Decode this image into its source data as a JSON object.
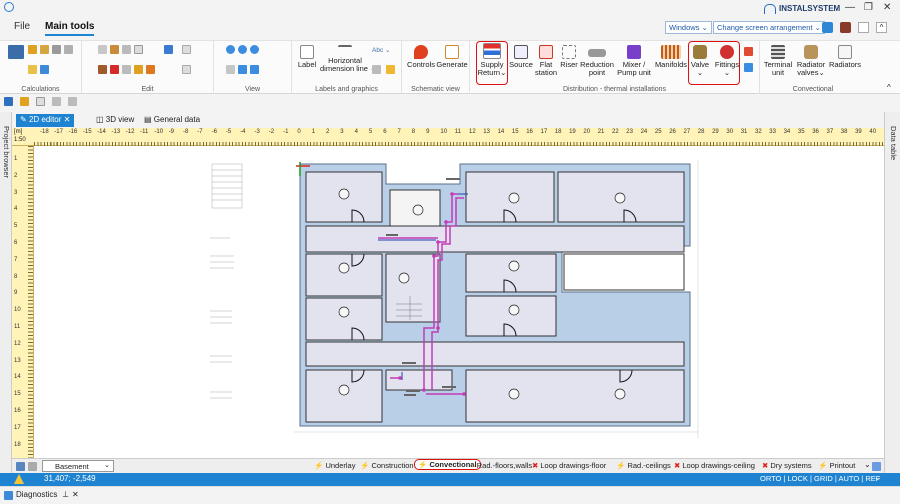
{
  "titlebar": {
    "brand": "INSTALSYSTEM",
    "min": "—",
    "restore": "❐",
    "close": "✕"
  },
  "menu": {
    "file": "File",
    "main_tools": "Main tools"
  },
  "topright": {
    "windows": "Windows ⌄",
    "screen": "Change screen arrangement ⌄"
  },
  "groups": {
    "calculations": "Calculations",
    "edit": "Edit",
    "view": "View",
    "labels": "Labels and graphics",
    "schematic": "Schematic view",
    "distribution": "Distribution - thermal installations",
    "convectional": "Convectional"
  },
  "buttons": {
    "label": "Label",
    "horizontal": "Horizontal",
    "dimension": "dimension line ⌄",
    "controls": "Controls",
    "generate": "Generate",
    "supply": "Supply",
    "return": "Return⌄",
    "source": "Source",
    "flat": "Flat",
    "station": "station",
    "riser": "Riser",
    "reduction": "Reduction",
    "point": "point",
    "mixer": "Mixer /",
    "pump": "Pump unit",
    "manifolds": "Manifolds",
    "valve": "Valve",
    "fittings": "Fittings",
    "terminal": "Terminal",
    "unit": "unit",
    "radiator": "Radiator",
    "valves": "valves⌄",
    "radiators": "Radiators",
    "abc": "Abc ⌄"
  },
  "tabs": {
    "editor": "2D editor",
    "view3d": "3D view",
    "general": "General data"
  },
  "side": {
    "left": "Project browser",
    "right": "Data table"
  },
  "ruler": {
    "unit": "[m]",
    "top_scale": "1:50"
  },
  "ruler_numbers": [
    "-18",
    "-17",
    "-16",
    "-15",
    "-14",
    "-13",
    "-12",
    "-11",
    "-10",
    "-9",
    "-8",
    "-7",
    "-6",
    "-5",
    "-4",
    "-3",
    "-2",
    "-1",
    "0",
    "1",
    "2",
    "3",
    "4",
    "5",
    "6",
    "7",
    "8",
    "9",
    "10",
    "11",
    "12",
    "13",
    "14",
    "15",
    "16",
    "17",
    "18",
    "19",
    "20",
    "21",
    "22",
    "23",
    "24",
    "25",
    "26",
    "27",
    "28",
    "29",
    "30",
    "31",
    "32",
    "33",
    "34",
    "35",
    "36",
    "37",
    "38",
    "39",
    "40"
  ],
  "ruler_left_numbers": [
    "1",
    "2",
    "3",
    "4",
    "5",
    "6",
    "7",
    "8",
    "9",
    "10",
    "11",
    "12",
    "13",
    "14",
    "15",
    "16",
    "17",
    "18"
  ],
  "bottom": {
    "level": "Basement",
    "layers": [
      "Underlay",
      "Construction",
      "Convectional",
      "Rad.-floors,walls",
      "Loop drawings-floor",
      "Rad.-ceilings",
      "Loop drawings-ceiling",
      "Dry systems",
      "Printout"
    ]
  },
  "status": {
    "coords": "31,407; -2,549",
    "modes": "ORTO | LOCK | GRID | AUTO | REF"
  },
  "diag": {
    "label": "Diagnostics"
  },
  "colors": {
    "accent": "#1e84d2",
    "pipe": "#c43ab8",
    "wall": "#b9cfe8",
    "room": "#e3e2ef",
    "highlight": "#d11111",
    "ruler": "#fff3b8"
  }
}
